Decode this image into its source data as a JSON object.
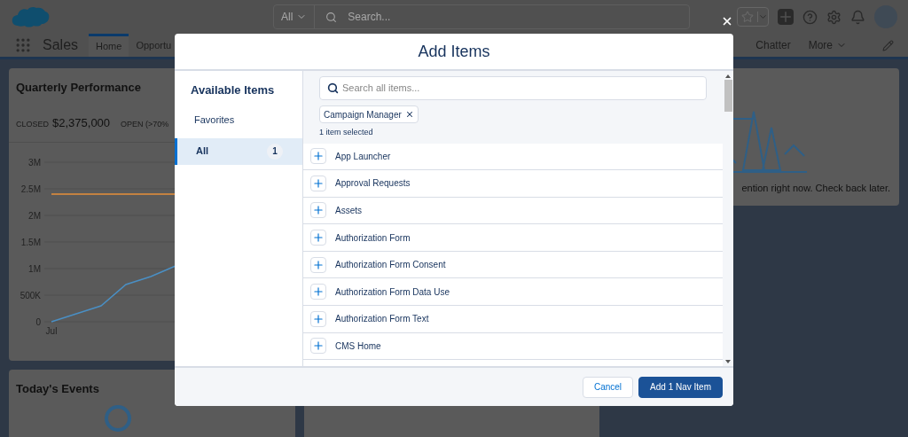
{
  "header": {
    "search_scope": "All",
    "search": {
      "placeholder": "Search..."
    }
  },
  "nav": {
    "app_name": "Sales",
    "tabs": [
      {
        "label": "Home",
        "selected": true
      },
      {
        "label": "Opportu",
        "selected": false
      }
    ],
    "right_tabs": [
      {
        "label": "Chatter",
        "kind": "link"
      },
      {
        "label": "More",
        "kind": "menu"
      }
    ]
  },
  "performance_card": {
    "title": "Quarterly Performance",
    "closed_label": "CLOSED",
    "closed_value": "$2,375,000",
    "open_label": "OPEN (>70%",
    "axis_start_label": "Jul",
    "chart_data": {
      "type": "line",
      "grid": true,
      "ylim": [
        0,
        3000000
      ],
      "yticks": [
        {
          "value": 0,
          "label": "0"
        },
        {
          "value": 500000,
          "label": "500K"
        },
        {
          "value": 1000000,
          "label": "1M"
        },
        {
          "value": 1500000,
          "label": "1.5M"
        },
        {
          "value": 2000000,
          "label": "2M"
        },
        {
          "value": 2500000,
          "label": "2.5M"
        },
        {
          "value": 3000000,
          "label": "3M"
        }
      ],
      "series": [
        {
          "color": "#4a8fc4",
          "values": [
            0,
            150000,
            300000,
            700000,
            850000,
            1050000
          ]
        },
        {
          "color": "#e8913a",
          "values": [
            2400000,
            2400000,
            2400000,
            2400000,
            2400000,
            2400000
          ]
        }
      ]
    }
  },
  "assistant_card": {
    "message": "ention right now. Check back later."
  },
  "events_card": {
    "title": "Today's Events"
  },
  "modal": {
    "title": "Add Items",
    "categories_title": "Available Items",
    "categories": [
      {
        "label": "Favorites",
        "selected": false
      },
      {
        "label": "All",
        "count": "1",
        "selected": true
      }
    ],
    "search": {
      "placeholder": "Search all items..."
    },
    "selected_pills": [
      "Campaign Manager"
    ],
    "selection_note": "1 item selected",
    "items": [
      "App Launcher",
      "Approval Requests",
      "Assets",
      "Authorization Form",
      "Authorization Form Consent",
      "Authorization Form Data Use",
      "Authorization Form Text",
      "CMS Home"
    ],
    "buttons": [
      {
        "label": "Cancel",
        "kind": "neutral"
      },
      {
        "label": "Add 1 Nav Item",
        "kind": "brand"
      }
    ]
  }
}
